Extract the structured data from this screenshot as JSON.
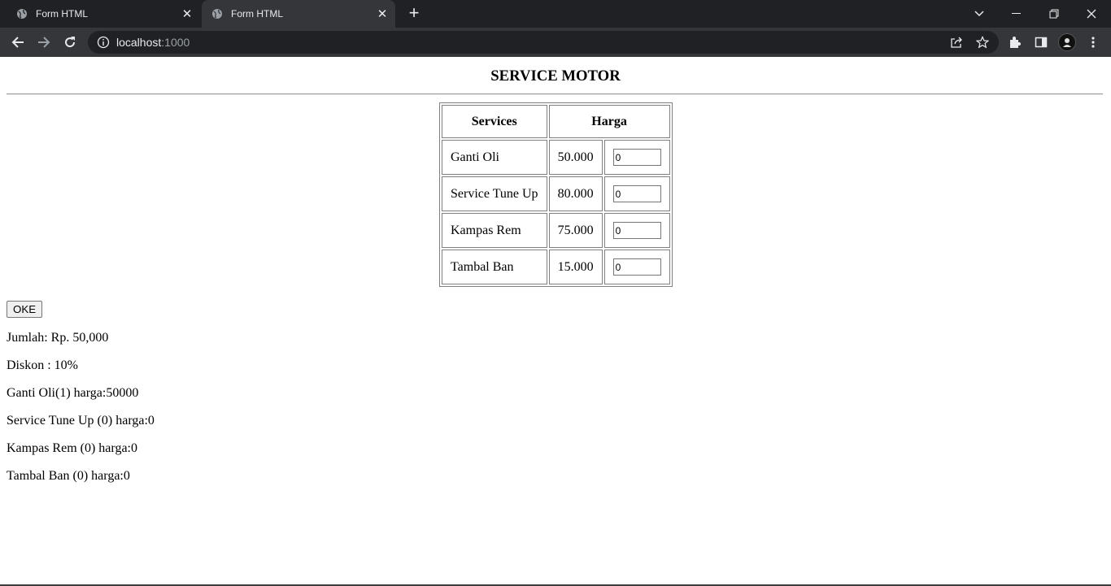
{
  "browser": {
    "tabs": [
      {
        "title": "Form HTML"
      },
      {
        "title": "Form HTML"
      }
    ],
    "url_host": "localhost",
    "url_port": ":1000"
  },
  "page": {
    "heading": "SERVICE MOTOR",
    "table": {
      "headers": [
        "Services",
        "Harga"
      ],
      "rows": [
        {
          "service": "Ganti Oli",
          "price": "50.000",
          "qty": "0"
        },
        {
          "service": "Service Tune Up",
          "price": "80.000",
          "qty": "0"
        },
        {
          "service": "Kampas Rem",
          "price": "75.000",
          "qty": "0"
        },
        {
          "service": "Tambal Ban",
          "price": "15.000",
          "qty": "0"
        }
      ]
    },
    "submit_label": "OKE",
    "results": [
      "Jumlah: Rp. 50,000",
      "Diskon : 10%",
      "Ganti Oli(1) harga:50000",
      "Service Tune Up (0) harga:0",
      "Kampas Rem (0) harga:0",
      "Tambal Ban (0) harga:0"
    ]
  }
}
